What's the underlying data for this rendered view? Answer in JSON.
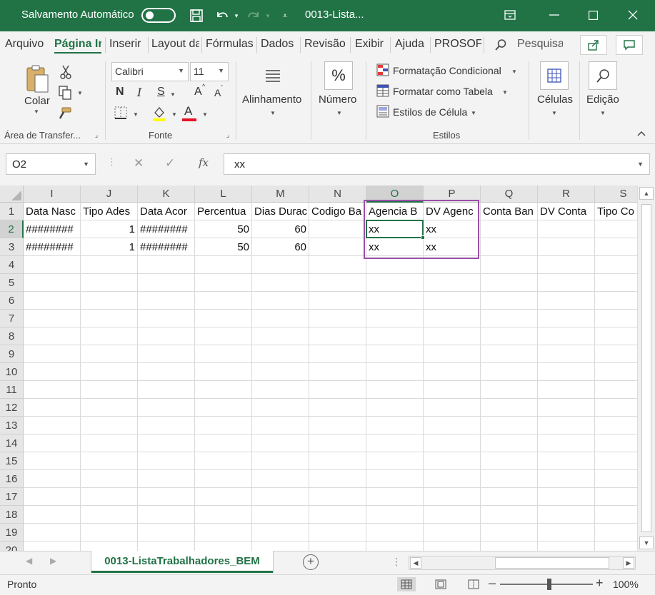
{
  "titlebar": {
    "autosave_label": "Salvamento Automático",
    "filename": "0013-Lista..."
  },
  "tabs": [
    "Arquivo",
    "Página Ir",
    "Inserir",
    "Layout da",
    "Fórmulas",
    "Dados",
    "Revisão",
    "Exibir",
    "Ajuda",
    "PROSOFT",
    "Pesquisa"
  ],
  "ribbon": {
    "clipboard": {
      "paste_label": "Colar",
      "group_label": "Área de Transfer..."
    },
    "font": {
      "name": "Calibri",
      "size": "11",
      "bold": "N",
      "italic": "I",
      "underline": "S",
      "grow": "A",
      "shrink": "A",
      "font_color_letter": "A",
      "group_label": "Fonte"
    },
    "alignment_label": "Alinhamento",
    "number_label": "Número",
    "styles": {
      "conditional": "Formatação Condicional",
      "table": "Formatar como Tabela",
      "cell_styles": "Estilos de Célula",
      "group_label": "Estilos"
    },
    "cells_label": "Células",
    "editing_label": "Edição"
  },
  "formula_bar": {
    "name_box": "O2",
    "content": "xx"
  },
  "grid": {
    "columns": [
      "I",
      "J",
      "K",
      "L",
      "M",
      "N",
      "O",
      "P",
      "Q",
      "R",
      "S"
    ],
    "rows": [
      "1",
      "2",
      "3",
      "4",
      "5",
      "6",
      "7",
      "8",
      "9",
      "10",
      "11",
      "12",
      "13",
      "14",
      "15",
      "16",
      "17",
      "18",
      "19",
      "20"
    ],
    "header_row": [
      "Data Nasc",
      "Tipo Ades",
      "Data Acor",
      "Percentua",
      "Dias Durac",
      "Codigo Ba",
      "Agencia B",
      "DV Agenc",
      "Conta Ban",
      "DV Conta",
      "Tipo Co"
    ],
    "data_rows": [
      [
        "########",
        "1",
        "########",
        "50",
        "60",
        "",
        "xx",
        "xx",
        "",
        "",
        ""
      ],
      [
        "########",
        "1",
        "########",
        "50",
        "60",
        "",
        "xx",
        "xx",
        "",
        "",
        ""
      ]
    ]
  },
  "sheet_tab": "0013-ListaTrabalhadores_BEM",
  "status": {
    "ready": "Pronto",
    "zoom": "100%"
  }
}
